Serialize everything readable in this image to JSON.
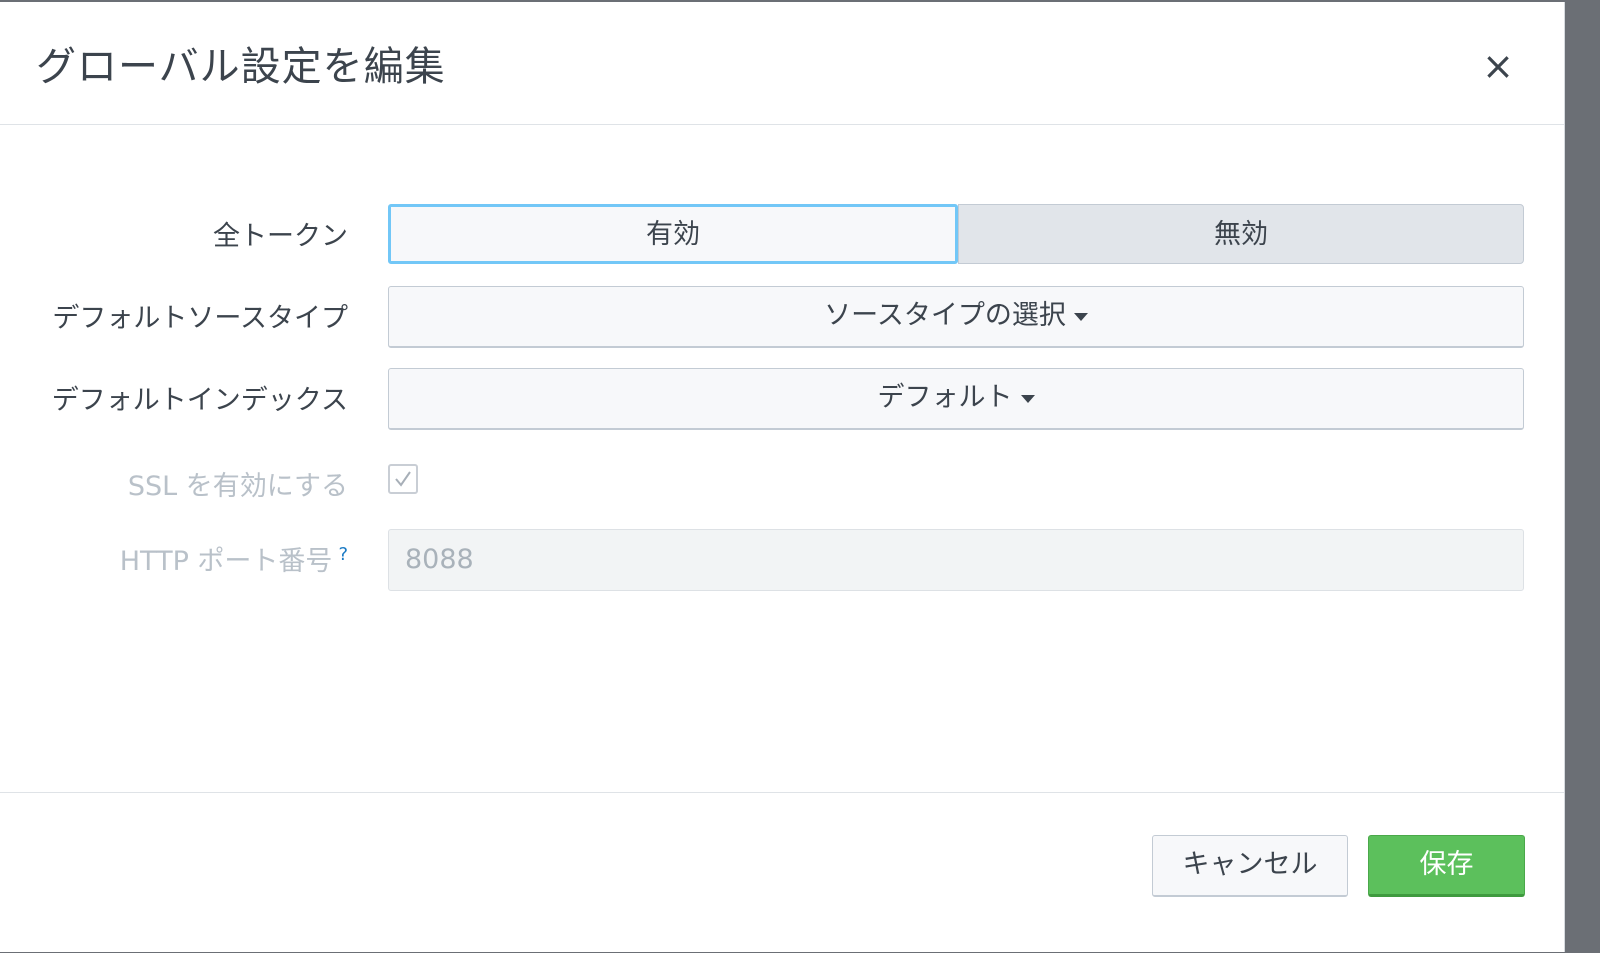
{
  "dialog": {
    "title": "グローバル設定を編集",
    "close_label": "×"
  },
  "form": {
    "all_tokens": {
      "label": "全トークン",
      "options": [
        "有効",
        "無効"
      ],
      "selected": "有効"
    },
    "default_sourcetype": {
      "label": "デフォルトソースタイプ",
      "value": "ソースタイプの選択"
    },
    "default_index": {
      "label": "デフォルトインデックス",
      "value": "デフォルト"
    },
    "enable_ssl": {
      "label": "SSL を有効にする",
      "checked": true
    },
    "http_port": {
      "label": "HTTP ポート番号",
      "help": "?",
      "value": "8088"
    }
  },
  "footer": {
    "cancel_label": "キャンセル",
    "save_label": "保存"
  },
  "colors": {
    "save_button": "#5cc05c",
    "focus_outline": "#72c7f7"
  }
}
